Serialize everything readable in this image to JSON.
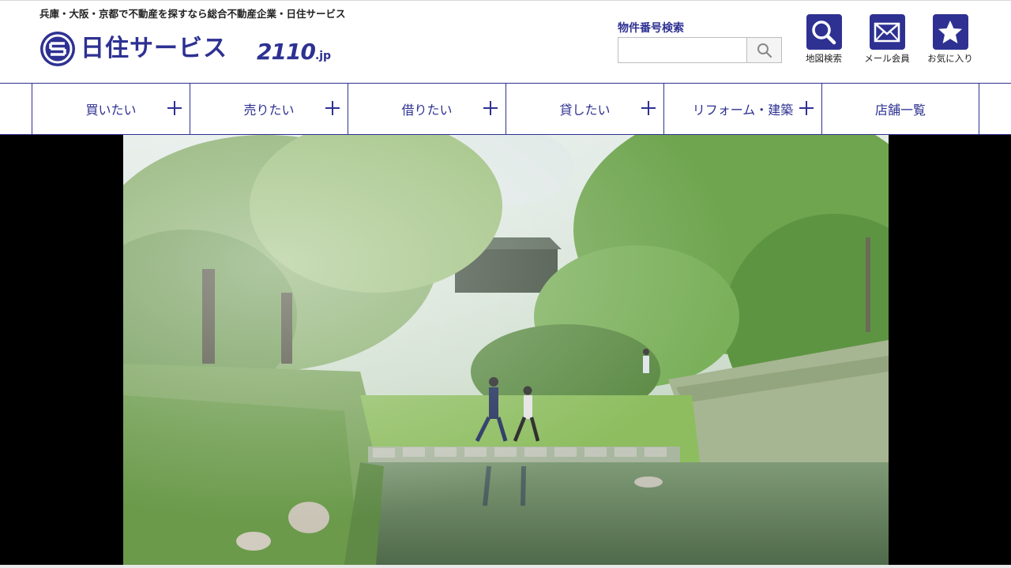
{
  "header": {
    "tagline": "兵庫・大阪・京都で不動産を探すなら総合不動産企業・日住サービス",
    "logo": {
      "name": "日住サービス",
      "sub_logo_main": "2110",
      "sub_logo_suffix": ".jp"
    }
  },
  "search": {
    "label": "物件番号検索",
    "value": "",
    "placeholder": ""
  },
  "utility": [
    {
      "label": "地図検索",
      "icon": "search-icon"
    },
    {
      "label": "メール会員",
      "icon": "mail-icon"
    },
    {
      "label": "お気に入り",
      "icon": "star-icon"
    }
  ],
  "nav": [
    {
      "label": "買いたい",
      "has_submenu": true
    },
    {
      "label": "売りたい",
      "has_submenu": true
    },
    {
      "label": "借りたい",
      "has_submenu": true
    },
    {
      "label": "貸したい",
      "has_submenu": true
    },
    {
      "label": "リフォーム・建築",
      "has_submenu": true
    },
    {
      "label": "店舗一覧",
      "has_submenu": false
    }
  ],
  "colors": {
    "brand": "#2e3192",
    "hero_letterbox": "#000000"
  }
}
